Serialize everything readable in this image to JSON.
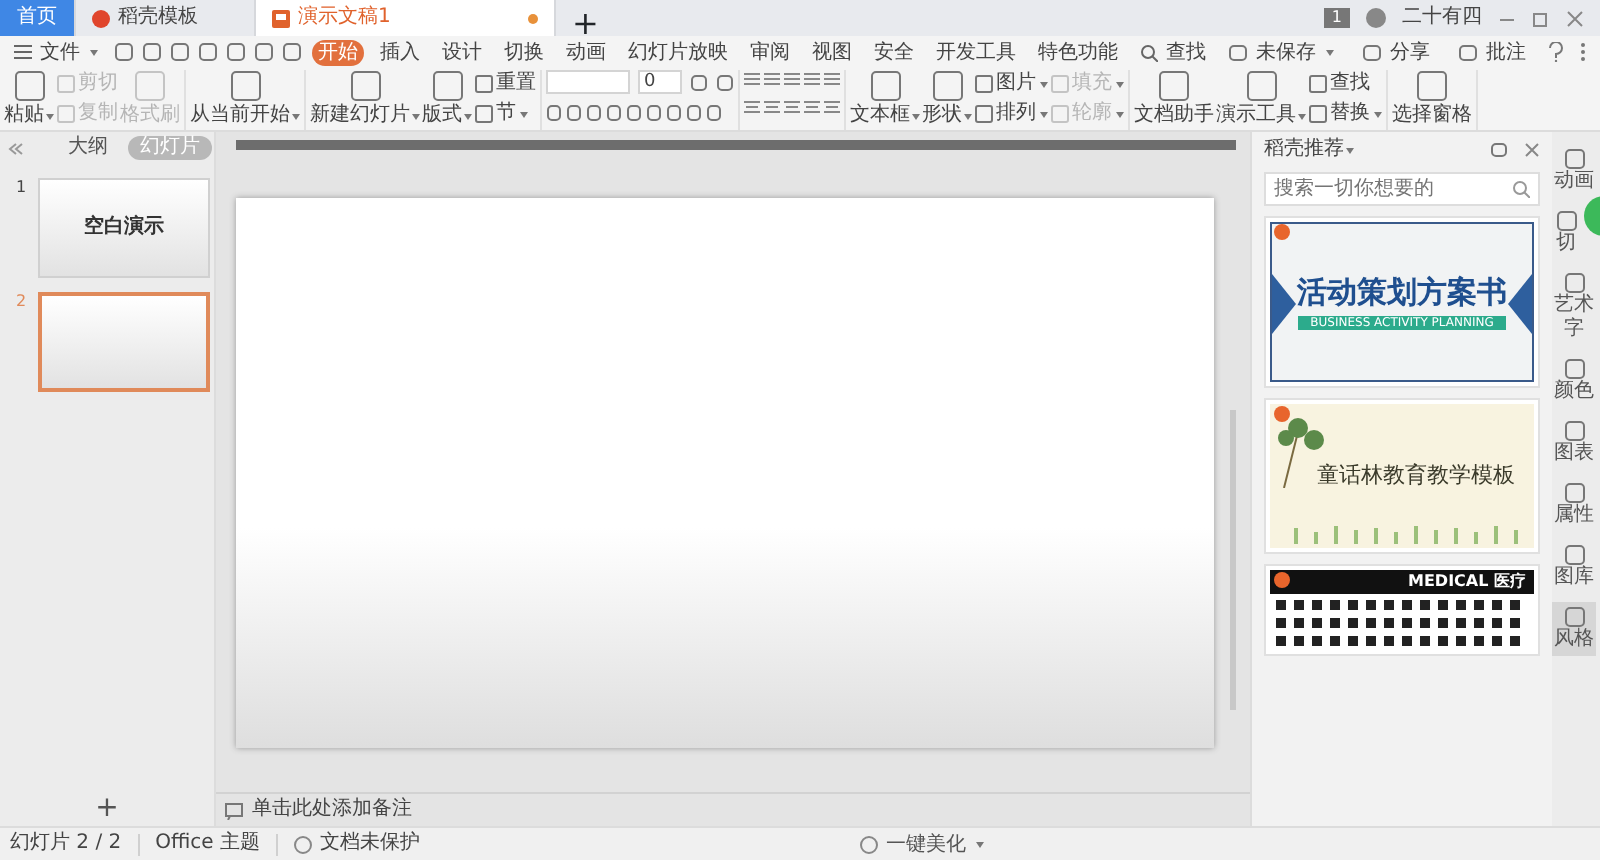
{
  "tabs": [
    {
      "label": "首页",
      "kind": "home",
      "selected": false
    },
    {
      "label": "稻壳模板",
      "kind": "docer",
      "selected": false
    },
    {
      "label": "演示文稿1",
      "kind": "doc",
      "selected": true,
      "modified": true
    }
  ],
  "new_tab": "+",
  "notification_count": "1",
  "user": "二十有四",
  "menu": {
    "file": "文件",
    "tabs": [
      {
        "label": "开始",
        "selected": true
      },
      {
        "label": "插入",
        "selected": false
      },
      {
        "label": "设计",
        "selected": false
      },
      {
        "label": "切换",
        "selected": false
      },
      {
        "label": "动画",
        "selected": false
      },
      {
        "label": "幻灯片放映",
        "selected": false
      },
      {
        "label": "审阅",
        "selected": false
      },
      {
        "label": "视图",
        "selected": false
      },
      {
        "label": "安全",
        "selected": false
      },
      {
        "label": "开发工具",
        "selected": false
      },
      {
        "label": "特色功能",
        "selected": false
      }
    ],
    "search": "查找"
  },
  "doc_actions": [
    {
      "label": "未保存",
      "dropdown": true
    },
    {
      "label": "分享",
      "dropdown": false
    },
    {
      "label": "批注",
      "dropdown": false
    }
  ],
  "ribbon": [
    {
      "kind": "buttons",
      "columns": [
        [
          {
            "kind": "large",
            "label": "粘贴",
            "dropdown": true,
            "disabled": false
          }
        ],
        [
          {
            "kind": "small",
            "label": "剪切",
            "dropdown": false,
            "disabled": true
          },
          {
            "kind": "small",
            "label": "复制",
            "dropdown": false,
            "disabled": true
          }
        ],
        [
          {
            "kind": "large",
            "label": "格式刷",
            "dropdown": false,
            "disabled": true
          }
        ]
      ]
    },
    {
      "kind": "buttons",
      "columns": [
        [
          {
            "kind": "large",
            "label": "从当前开始",
            "dropdown": true,
            "disabled": false
          }
        ]
      ]
    },
    {
      "kind": "buttons",
      "columns": [
        [
          {
            "kind": "large",
            "label": "新建幻灯片",
            "dropdown": true,
            "disabled": false
          }
        ],
        [
          {
            "kind": "large",
            "label": "版式",
            "dropdown": true,
            "disabled": false
          }
        ],
        [
          {
            "kind": "small",
            "label": "重置",
            "dropdown": false,
            "disabled": false
          },
          {
            "kind": "small",
            "label": "节",
            "dropdown": true,
            "disabled": false
          }
        ]
      ]
    },
    {
      "kind": "font",
      "size": "0"
    },
    {
      "kind": "paragraph"
    },
    {
      "kind": "buttons",
      "columns": [
        [
          {
            "kind": "large",
            "label": "文本框",
            "dropdown": true,
            "disabled": false
          }
        ],
        [
          {
            "kind": "large",
            "label": "形状",
            "dropdown": true,
            "disabled": false
          }
        ],
        [
          {
            "kind": "small",
            "label": "图片",
            "dropdown": true,
            "disabled": false
          },
          {
            "kind": "small",
            "label": "排列",
            "dropdown": true,
            "disabled": false
          }
        ],
        [
          {
            "kind": "small",
            "label": "填充",
            "dropdown": true,
            "disabled": true
          },
          {
            "kind": "small",
            "label": "轮廓",
            "dropdown": true,
            "disabled": true
          }
        ]
      ]
    },
    {
      "kind": "buttons",
      "columns": [
        [
          {
            "kind": "large",
            "label": "文档助手",
            "dropdown": false,
            "disabled": false
          }
        ],
        [
          {
            "kind": "large",
            "label": "演示工具",
            "dropdown": true,
            "disabled": false
          }
        ],
        [
          {
            "kind": "small",
            "label": "查找",
            "dropdown": false,
            "disabled": false
          },
          {
            "kind": "small",
            "label": "替换",
            "dropdown": true,
            "disabled": false
          }
        ]
      ]
    },
    {
      "kind": "buttons",
      "columns": [
        [
          {
            "kind": "large",
            "label": "选择窗格",
            "dropdown": false,
            "disabled": false
          }
        ]
      ]
    }
  ],
  "view_tabs": [
    {
      "label": "大纲",
      "selected": false
    },
    {
      "label": "幻灯片",
      "selected": true
    }
  ],
  "slides": [
    {
      "number": "1",
      "title": "空白演示",
      "selected": false
    },
    {
      "number": "2",
      "selected": true
    }
  ],
  "add_slide": "+",
  "notes_placeholder": "单击此处添加备注",
  "panel": {
    "title": "稻壳推荐",
    "search_placeholder": "搜索一切你想要的",
    "templates": [
      {
        "kind": "banner",
        "title": "活动策划方案书",
        "subtitle": "BUSINESS ACTIVITY PLANNING"
      },
      {
        "kind": "nature",
        "title": "童话林教育教学模板"
      },
      {
        "kind": "icons",
        "title": "MEDICAL 医疗"
      }
    ]
  },
  "side_tools": [
    {
      "label": "动画",
      "selected": false
    },
    {
      "label": "切",
      "selected": false
    },
    {
      "label": "艺术字",
      "selected": false
    },
    {
      "label": "颜色",
      "selected": false
    },
    {
      "label": "图表",
      "selected": false
    },
    {
      "label": "属性",
      "selected": false
    },
    {
      "label": "图库",
      "selected": false
    },
    {
      "label": "风格",
      "selected": true
    }
  ],
  "status": [
    "幻灯片 2 / 2",
    "Office 主题",
    "文档未保护"
  ],
  "beautify": "一键美化"
}
